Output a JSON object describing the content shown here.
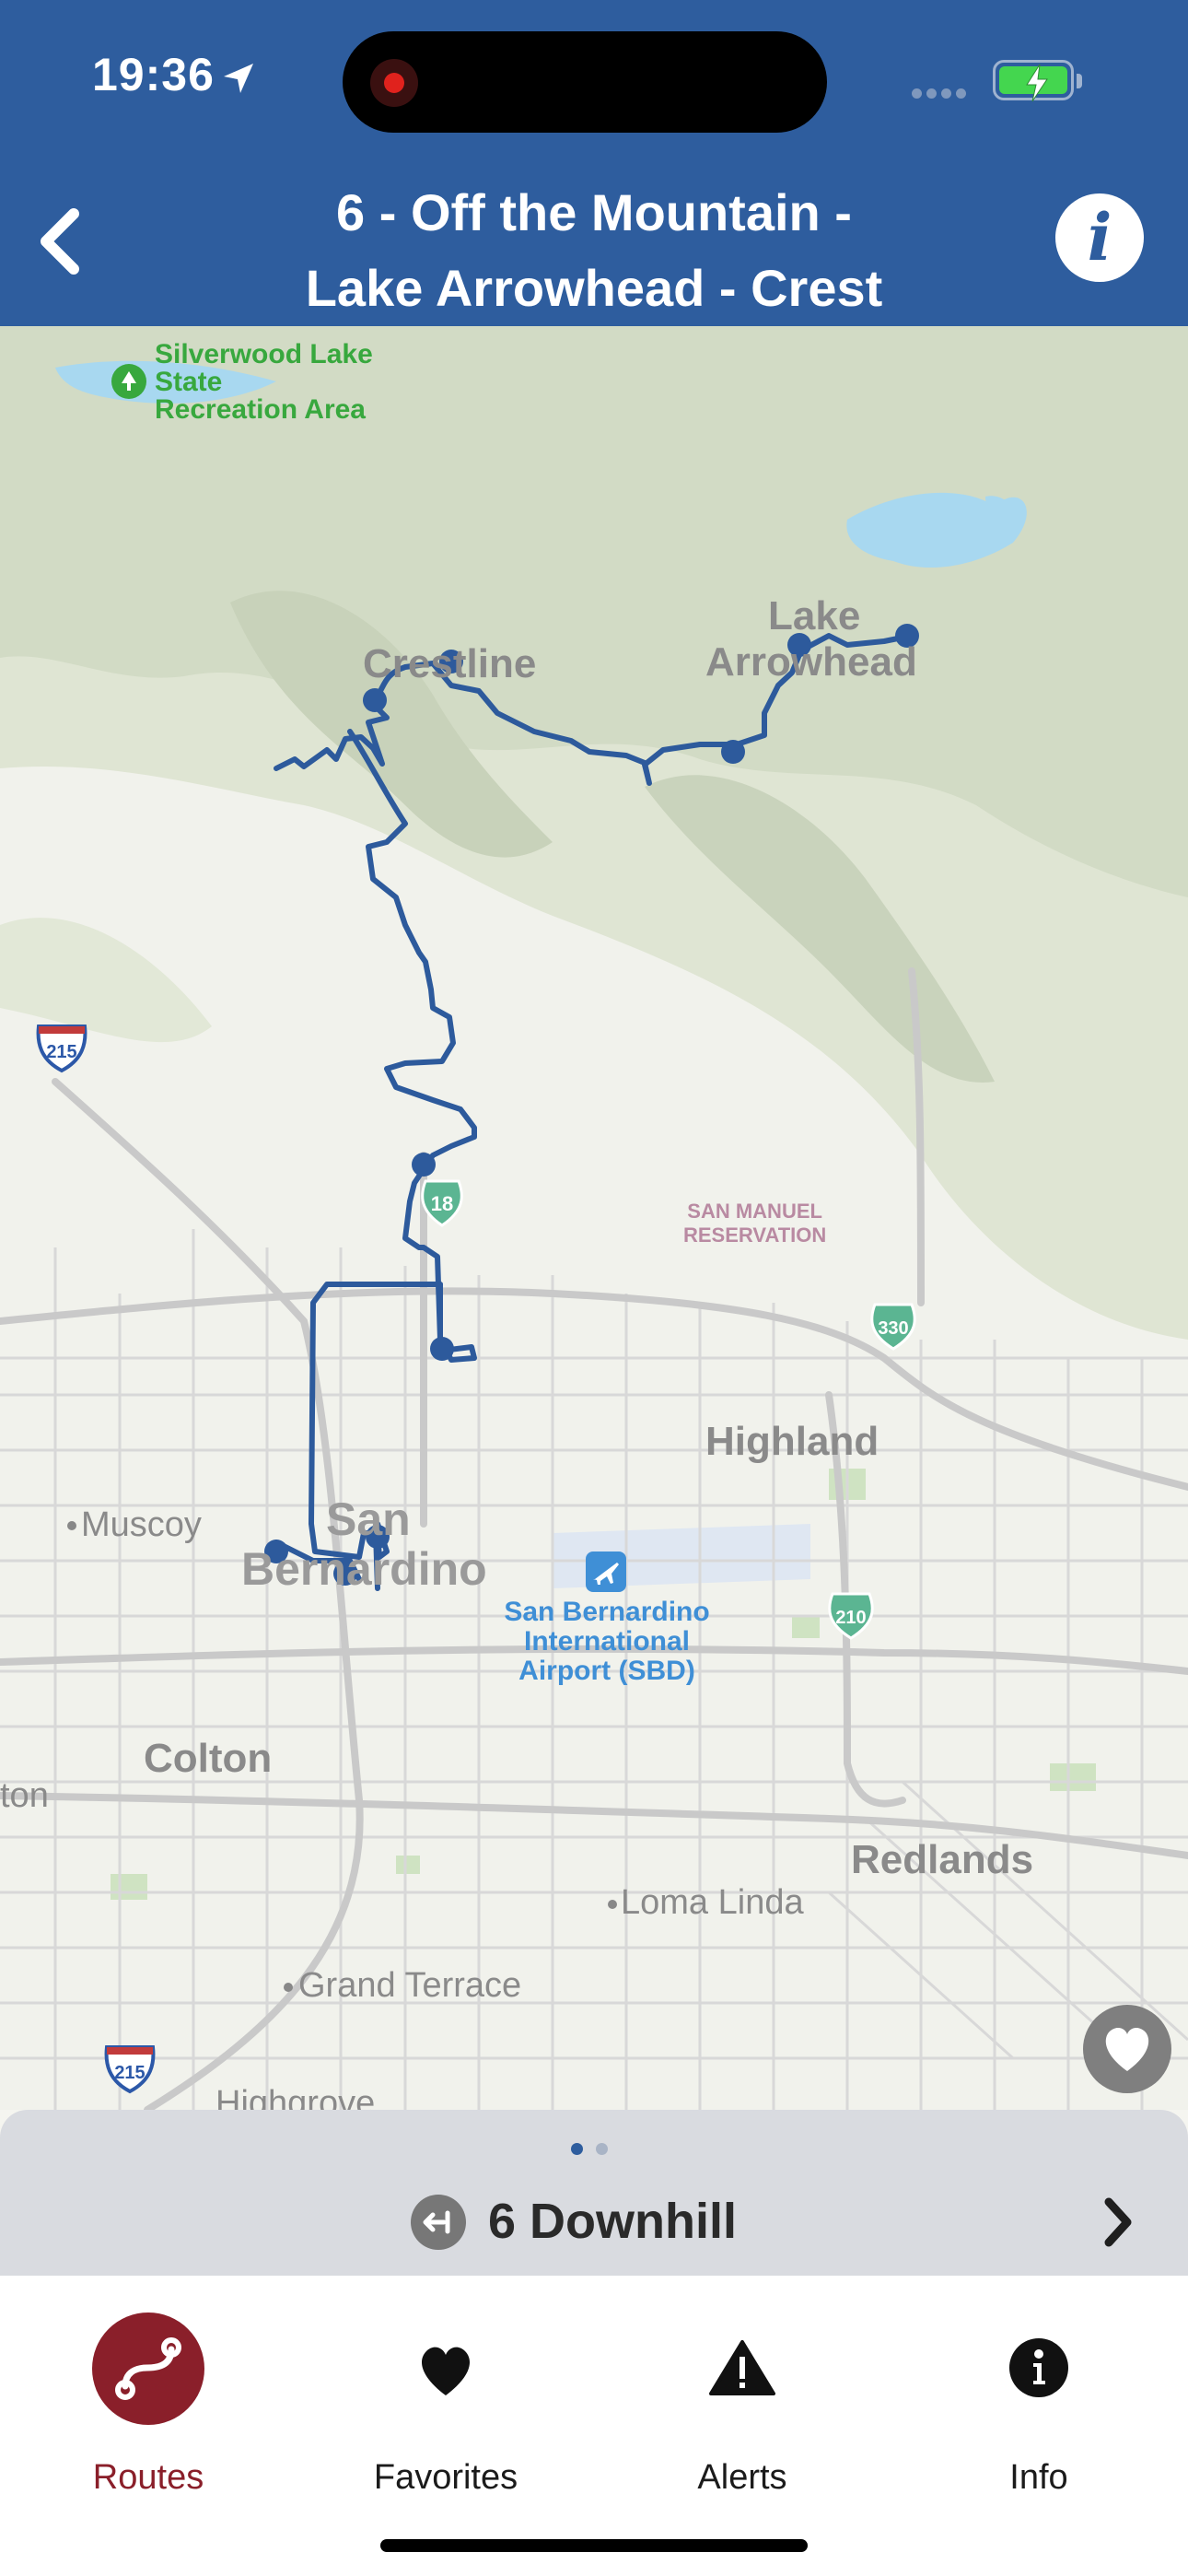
{
  "status_bar": {
    "time": "19:36"
  },
  "header": {
    "title_line1": "6 - Off the Mountain -",
    "title_line2": "Lake Arrowhead - Crest"
  },
  "map": {
    "labels": {
      "silverwood": [
        "Silverwood Lake",
        "State",
        "Recreation Area"
      ],
      "crestline": "Crestline",
      "lake_arrowhead": [
        "Lake",
        "Arrowhead"
      ],
      "muscoy": "Muscoy",
      "san_manuel": [
        "SAN MANUEL",
        "RESERVATION"
      ],
      "highland": "Highland",
      "san_bernardino": [
        "San",
        "Bernardino"
      ],
      "airport": [
        "San Bernardino",
        "International",
        "Airport (SBD)"
      ],
      "colton": "Colton",
      "rialto_partial": "ton",
      "redlands": "Redlands",
      "loma_linda": "Loma Linda",
      "grand_terrace": "Grand Terrace",
      "highgrove": "Highgrove"
    },
    "shields": {
      "i215_north": "215",
      "i215_south": "215",
      "sr18": "18",
      "sr330": "330",
      "sr210": "210"
    },
    "route_color": "#2d5a9c"
  },
  "route_panel": {
    "title": "6 Downhill",
    "page_count": 2,
    "active_page": 1
  },
  "tabs": [
    {
      "id": "routes",
      "label": "Routes",
      "active": true
    },
    {
      "id": "favorites",
      "label": "Favorites",
      "active": false
    },
    {
      "id": "alerts",
      "label": "Alerts",
      "active": false
    },
    {
      "id": "info",
      "label": "Info",
      "active": false
    }
  ],
  "colors": {
    "header_bg": "#2e5d9e",
    "accent": "#8a1f2a",
    "route": "#2d5a9c"
  }
}
